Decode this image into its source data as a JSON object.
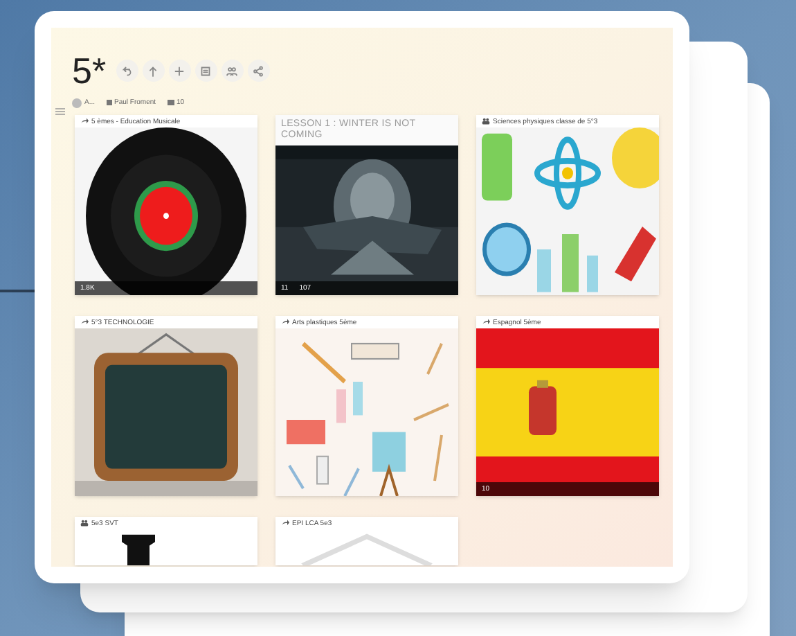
{
  "title": "5*",
  "toolbar": [
    {
      "kind": "back"
    },
    {
      "kind": "up"
    },
    {
      "kind": "add"
    },
    {
      "kind": "note"
    },
    {
      "kind": "team"
    },
    {
      "kind": "share"
    }
  ],
  "meta": [
    {
      "kind": "avatar",
      "text": "A..."
    },
    {
      "kind": "author",
      "text": "Paul Froment"
    },
    {
      "kind": "count",
      "text": "10"
    }
  ],
  "cards": [
    {
      "kind": "link",
      "title": "5 èmes - Education Musicale",
      "image": {
        "kind": "record"
      },
      "stats": [
        "1.8K"
      ]
    },
    {
      "kind": "note",
      "title": "LESSON 1 : WINTER IS NOT COMING",
      "image": {
        "kind": "video"
      },
      "stats": [
        "11",
        "107"
      ]
    },
    {
      "kind": "team",
      "title": "Sciences physiques classe de 5°3",
      "image": {
        "kind": "science"
      }
    },
    {
      "kind": "link",
      "title": "5°3 TECHNOLOGIE",
      "image": {
        "kind": "board"
      }
    },
    {
      "kind": "link",
      "title": "Arts plastiques 5ème",
      "image": {
        "kind": "art"
      }
    },
    {
      "kind": "link",
      "title": "Espagnol 5ème",
      "image": {
        "kind": "flag"
      },
      "stats": [
        "10"
      ]
    },
    {
      "kind": "team",
      "title": "5e3 SVT",
      "image": {
        "kind": "bust"
      }
    },
    {
      "kind": "link",
      "title": "EPI LCA 5e3",
      "image": {
        "kind": "temple"
      }
    }
  ]
}
